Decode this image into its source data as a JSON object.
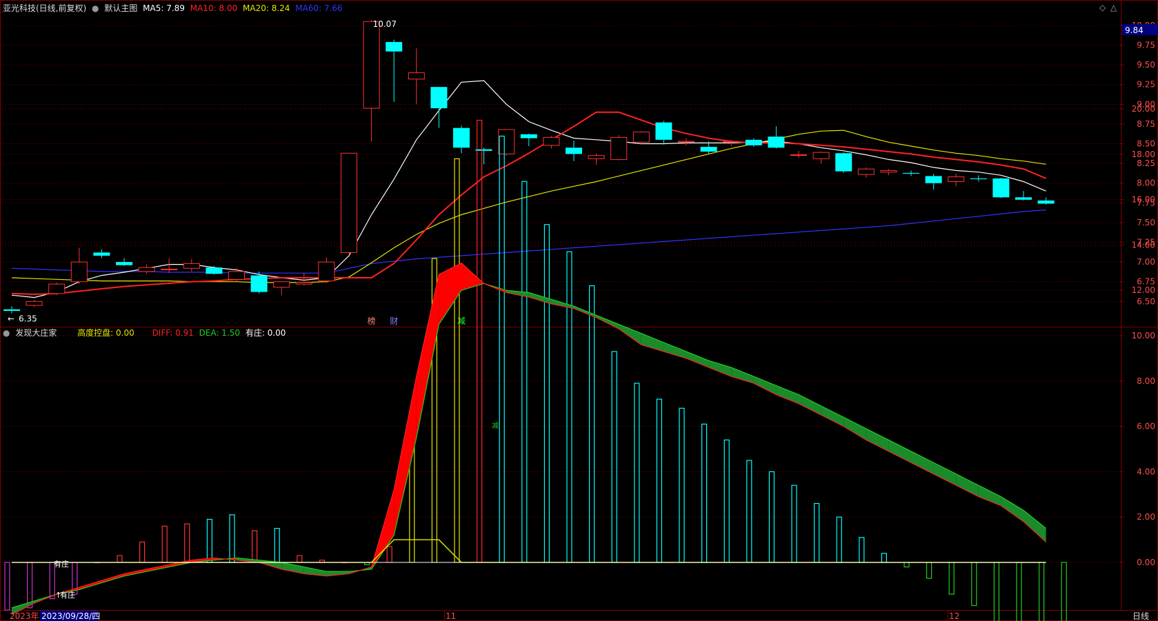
{
  "header": {
    "title": "亚光科技(日线,前复权)",
    "main_chart_label": "默认主图",
    "ma": [
      {
        "label": "MA5: 7.89",
        "color": "#ffffff"
      },
      {
        "label": "MA10: 8.00",
        "color": "#ff2222"
      },
      {
        "label": "MA20: 8.24",
        "color": "#e6e600"
      },
      {
        "label": "MA60: 7.66",
        "color": "#3333ff"
      }
    ]
  },
  "indicator_header": {
    "name": "发现大庄家",
    "items": [
      {
        "label": "高度控盘: 0.00",
        "color": "#e6e600"
      },
      {
        "label": "DIFF: 0.91",
        "color": "#ff2222"
      },
      {
        "label": "DEA: 1.50",
        "color": "#22cc22"
      },
      {
        "label": "有庄: 0.00",
        "color": "#ffffff"
      }
    ]
  },
  "price_axis": {
    "ticks": [
      "10.00",
      "9.75",
      "9.50",
      "9.25",
      "9.00",
      "8.75",
      "8.50",
      "8.25",
      "8.00",
      "7.75",
      "7.50",
      "7.25",
      "7.00",
      "6.75",
      "6.50"
    ],
    "current_price": "9.84"
  },
  "indicator_axis": {
    "ticks": [
      "20.00",
      "18.00",
      "16.00",
      "14.00",
      "12.00",
      "10.00",
      "8.00",
      "6.00",
      "4.00",
      "2.00",
      "0.00"
    ]
  },
  "annotations": {
    "high_label": "10.07",
    "low_label": "6.35",
    "event_marks": [
      {
        "text": "榜",
        "color": "#ff8080"
      },
      {
        "text": "财",
        "color": "#8080ff"
      },
      {
        "text": "减",
        "color": "#22ee22"
      }
    ],
    "youzhuang_1": "有庄",
    "youzhuang_2": "有庄",
    "jian_small": "减"
  },
  "time_axis": {
    "year": "2023年",
    "cursor_date": "2023/09/28/四",
    "month_11": "11",
    "month_12": "12",
    "period": "日线"
  },
  "colors": {
    "up": "#ff3333",
    "down": "#00ffff",
    "grid": "#800000",
    "axis_text": "#ff4d4d",
    "ma5": "#ffffff",
    "ma10": "#ff2222",
    "ma20": "#e6e600",
    "ma60": "#3333ff"
  },
  "chart_data": {
    "type": "candlestick",
    "candles": [
      [
        6.4,
        6.44,
        6.35,
        6.38
      ],
      [
        6.45,
        6.52,
        6.43,
        6.5
      ],
      [
        6.6,
        6.74,
        6.58,
        6.72
      ],
      [
        6.75,
        7.18,
        6.72,
        7.0
      ],
      [
        7.12,
        7.16,
        7.05,
        7.08
      ],
      [
        7.0,
        7.05,
        6.95,
        6.96
      ],
      [
        6.88,
        6.97,
        6.85,
        6.93
      ],
      [
        6.9,
        7.05,
        6.86,
        6.91
      ],
      [
        6.92,
        7.04,
        6.88,
        6.98
      ],
      [
        6.93,
        6.95,
        6.84,
        6.85
      ],
      [
        6.78,
        6.92,
        6.75,
        6.88
      ],
      [
        6.83,
        6.88,
        6.6,
        6.62
      ],
      [
        6.68,
        6.74,
        6.58,
        6.75
      ],
      [
        6.72,
        6.86,
        6.7,
        6.74
      ],
      [
        6.76,
        7.06,
        6.73,
        7.0
      ],
      [
        7.12,
        8.38,
        7.1,
        8.38
      ],
      [
        8.95,
        10.07,
        8.53,
        10.05
      ],
      [
        9.79,
        9.82,
        9.03,
        9.67
      ],
      [
        9.32,
        9.71,
        9.0,
        9.4
      ],
      [
        9.22,
        9.22,
        8.7,
        8.95
      ],
      [
        8.7,
        8.73,
        8.38,
        8.45
      ],
      [
        8.43,
        8.45,
        8.24,
        8.41
      ],
      [
        8.37,
        8.68,
        8.35,
        8.68
      ],
      [
        8.62,
        8.63,
        8.47,
        8.57
      ],
      [
        8.48,
        8.6,
        8.44,
        8.58
      ],
      [
        8.45,
        8.54,
        8.28,
        8.37
      ],
      [
        8.31,
        8.38,
        8.23,
        8.35
      ],
      [
        8.3,
        8.61,
        8.29,
        8.58
      ],
      [
        8.52,
        8.66,
        8.49,
        8.65
      ],
      [
        8.77,
        8.79,
        8.49,
        8.55
      ],
      [
        8.52,
        8.57,
        8.48,
        8.53
      ],
      [
        8.46,
        8.53,
        8.37,
        8.4
      ],
      [
        8.52,
        8.55,
        8.47,
        8.53
      ],
      [
        8.55,
        8.57,
        8.46,
        8.48
      ],
      [
        8.59,
        8.72,
        8.44,
        8.45
      ],
      [
        8.36,
        8.41,
        8.32,
        8.36
      ],
      [
        8.31,
        8.4,
        8.25,
        8.39
      ],
      [
        8.38,
        8.39,
        8.13,
        8.15
      ],
      [
        8.11,
        8.2,
        8.07,
        8.18
      ],
      [
        8.14,
        8.18,
        8.1,
        8.16
      ],
      [
        8.13,
        8.16,
        8.09,
        8.12
      ],
      [
        8.09,
        8.12,
        7.92,
        8.0
      ],
      [
        8.02,
        8.12,
        7.96,
        8.08
      ],
      [
        8.06,
        8.1,
        8.02,
        8.05
      ],
      [
        8.06,
        8.07,
        7.81,
        7.82
      ],
      [
        7.82,
        7.9,
        7.78,
        7.79
      ],
      [
        7.78,
        7.82,
        7.73,
        7.74
      ]
    ],
    "ma5": [
      6.58,
      6.55,
      6.62,
      6.75,
      6.83,
      6.87,
      6.92,
      6.97,
      6.97,
      6.93,
      6.9,
      6.84,
      6.8,
      6.77,
      6.8,
      7.08,
      7.6,
      8.05,
      8.55,
      8.92,
      9.28,
      9.3,
      9.0,
      8.78,
      8.67,
      8.57,
      8.55,
      8.53,
      8.5,
      8.5,
      8.51,
      8.51,
      8.51,
      8.52,
      8.53,
      8.5,
      8.45,
      8.41,
      8.36,
      8.3,
      8.26,
      8.2,
      8.16,
      8.14,
      8.1,
      8.02,
      7.9
    ],
    "ma10": [
      6.6,
      6.59,
      6.6,
      6.63,
      6.66,
      6.69,
      6.71,
      6.73,
      6.75,
      6.76,
      6.78,
      6.79,
      6.8,
      6.8,
      6.8,
      6.8,
      6.8,
      6.98,
      7.28,
      7.6,
      7.85,
      8.08,
      8.22,
      8.38,
      8.55,
      8.72,
      8.9,
      8.9,
      8.8,
      8.7,
      8.63,
      8.57,
      8.53,
      8.51,
      8.51,
      8.5,
      8.48,
      8.46,
      8.43,
      8.4,
      8.37,
      8.33,
      8.3,
      8.27,
      8.23,
      8.18,
      8.06
    ],
    "ma20": [
      6.8,
      6.79,
      6.78,
      6.77,
      6.76,
      6.76,
      6.76,
      6.76,
      6.75,
      6.75,
      6.75,
      6.74,
      6.74,
      6.74,
      6.75,
      6.81,
      6.99,
      7.18,
      7.35,
      7.49,
      7.6,
      7.68,
      7.76,
      7.83,
      7.9,
      7.96,
      8.02,
      8.09,
      8.16,
      8.23,
      8.3,
      8.37,
      8.44,
      8.5,
      8.56,
      8.62,
      8.66,
      8.67,
      8.59,
      8.52,
      8.47,
      8.42,
      8.38,
      8.35,
      8.31,
      8.28,
      8.24
    ],
    "ma60": [
      6.92,
      6.91,
      6.9,
      6.89,
      6.88,
      6.88,
      6.88,
      6.87,
      6.87,
      6.87,
      6.86,
      6.86,
      6.86,
      6.86,
      6.86,
      6.92,
      6.98,
      7.01,
      7.04,
      7.06,
      7.08,
      7.1,
      7.12,
      7.14,
      7.16,
      7.18,
      7.2,
      7.22,
      7.24,
      7.26,
      7.28,
      7.3,
      7.32,
      7.34,
      7.36,
      7.38,
      7.4,
      7.42,
      7.44,
      7.46,
      7.49,
      7.52,
      7.55,
      7.58,
      7.61,
      7.64,
      7.66
    ],
    "ind_bars": [
      -2.1,
      -2.0,
      -1.6,
      -1.4,
      0,
      0.3,
      0.9,
      1.6,
      1.7,
      1.9,
      2.1,
      1.4,
      1.5,
      0.3,
      0.1,
      0,
      -0.1,
      0.7,
      5.2,
      13.4,
      17.8,
      19.5,
      18.8,
      16.8,
      14.9,
      13.7,
      12.2,
      9.3,
      7.9,
      7.2,
      6.8,
      6.1,
      5.4,
      4.5,
      4.0,
      3.4,
      2.6,
      2.0,
      1.1,
      0.4,
      -0.2,
      -0.7,
      -1.4,
      -1.9,
      -2.6,
      -3.0,
      -3.3,
      -3.6
    ],
    "diff": [
      -2.3,
      -1.8,
      -1.4,
      -1.1,
      -0.8,
      -0.5,
      -0.3,
      -0.1,
      0.1,
      0.2,
      0.1,
      0.0,
      -0.3,
      -0.5,
      -0.6,
      -0.5,
      -0.2,
      3.2,
      8.2,
      12.7,
      13.2,
      12.3,
      11.9,
      11.7,
      11.4,
      11.2,
      10.8,
      10.3,
      9.6,
      9.3,
      9.0,
      8.6,
      8.2,
      7.9,
      7.4,
      7.0,
      6.5,
      6.0,
      5.4,
      4.9,
      4.4,
      3.9,
      3.4,
      2.9,
      2.5,
      1.8,
      0.9
    ],
    "dea": [
      -2.0,
      -1.7,
      -1.4,
      -1.2,
      -0.9,
      -0.6,
      -0.4,
      -0.2,
      0.0,
      0.1,
      0.2,
      0.1,
      0.0,
      -0.2,
      -0.4,
      -0.4,
      -0.3,
      1.2,
      5.5,
      10.5,
      12.0,
      12.3,
      12.0,
      11.9,
      11.6,
      11.3,
      10.9,
      10.5,
      10.1,
      9.7,
      9.3,
      8.9,
      8.6,
      8.2,
      7.8,
      7.4,
      6.9,
      6.4,
      5.9,
      5.4,
      4.9,
      4.4,
      3.9,
      3.4,
      2.9,
      2.3,
      1.5
    ],
    "control": [
      0,
      0,
      0,
      0,
      0,
      0,
      0,
      0,
      0,
      0,
      0,
      0,
      0,
      0,
      0,
      0,
      0,
      1.0,
      1.0,
      1.0,
      0,
      0,
      0,
      0,
      0,
      0,
      0,
      0,
      0,
      0,
      0,
      0,
      0,
      0,
      0,
      0,
      0,
      0,
      0,
      0,
      0,
      0,
      0,
      0,
      0,
      0,
      0
    ]
  }
}
